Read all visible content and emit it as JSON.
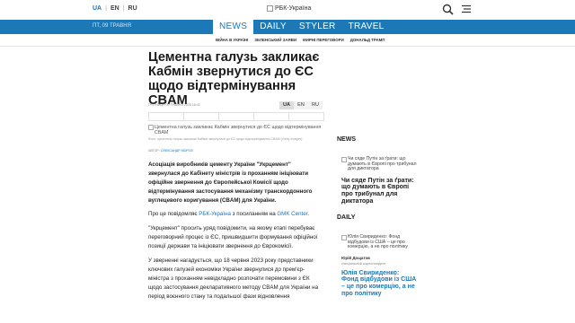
{
  "header": {
    "langs": [
      "UA",
      "EN",
      "RU"
    ],
    "logo_alt": "РБК-Україна",
    "date": "ПТ, 09 ТРАВНЯ"
  },
  "nav": {
    "tabs": [
      "NEWS",
      "DAILY",
      "STYLER",
      "TRAVEL"
    ],
    "subnav": [
      "ВІЙНА В УКРАЇНІ",
      "ЗЕЛЕНСЬКИЙ ЗАЯВИ",
      "МИРНІ ПЕРЕГОВОРИ",
      "ДОНАЛЬД ТРАМП"
    ]
  },
  "article": {
    "headline": "Цементна галузь закликає Кабмін звернутися до ЄС щодо відтермінування CBAM",
    "meta": "П'ЯТНИЦЯ 09 ТРАВНЯ 2025 18:42",
    "langs": [
      "UA",
      "EN",
      "RU"
    ],
    "image_alt": "Цементна галузь закликає Кабмін звернутися до ЄС щодо відтермінування CBAM",
    "caption": "Фото: цементна галузь закликає Кабмін звернутися до ЄС щодо відтермінування CBAM (Getty Images)",
    "author_label": "АВТОР:",
    "author_name": "ОЛЕКСАНДР МОРОЗ",
    "lead": "Асоціація виробників цементу України \"Укрцемент\" звернулася до Кабінету міністрів із проханням ініціювати офіційне звернення до Європейської Комісії щодо відтермінування застосування механізму транскордонного вуглецевого коригування (CBAM) для України.",
    "p1_before": "Про це повідомляє ",
    "p1_link1": "РБК-Україна",
    "p1_middle": " з посиланням на ",
    "p1_link2": "GMK Center",
    "p1_after": ".",
    "p2": "\"Укрцемент\" просить уряд повідомити, на якому етапі перебуває переговорний процес із ЄС, пришвидшити формування офіційної позиції держави та ініціювати звернення до Єврокомісії.",
    "p3": "У зверненні нагадується, що 18 червня 2023 року представники ключових галузей економіки України звернулися до прем'єр-міністра з проханням невідкладно розпочати перемовини з ЄК щодо застосування декларативного методу CBAM для України на період воєнного стану та подальшої фази відновлення"
  },
  "sidebar": {
    "news_heading": "NEWS",
    "news_img_alt": "Чи сяде Путін за ґрати: що думають в Європі про трибунал для диктатора",
    "news_title": "Чи сяде Путін за ґрати: що думають в Європі про трибунал для диктатора",
    "daily_heading": "DAILY",
    "daily_img_alt": "Юлія Свириденко: Фонд відбудови із США – це про комерцію, а не про політику",
    "daily_author": "Юрій Дощатов",
    "daily_role": "спеціальний кореспондент",
    "daily_title": "Юлія Свириденко: Фонд відбудови із США – це про комерцію, а не про політику"
  },
  "colors": {
    "brand_blue": "#1c78b6",
    "link": "#1a73b8"
  }
}
